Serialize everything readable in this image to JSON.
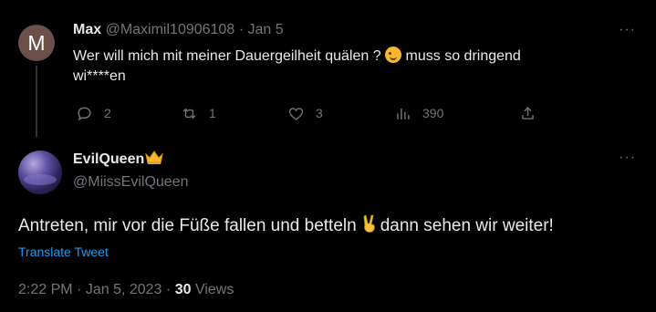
{
  "reply_tweet": {
    "avatar_letter": "M",
    "display_name": "Max",
    "handle": "@Maximil10906108",
    "separator": "·",
    "date": "Jan 5",
    "text_line1": "Wer will mich mit meiner Dauergeilheit quälen ?",
    "text_line1b": "muss so dringend",
    "text_line2": "wi****en",
    "more": "···",
    "actions": {
      "replies": "2",
      "retweets": "1",
      "likes": "3",
      "views": "390"
    }
  },
  "main_tweet": {
    "display_name": "EvilQueen",
    "handle": "@MiissEvilQueen",
    "more": "···",
    "text_part1": "Antreten, mir vor die Füße fallen und betteln",
    "text_part2": "dann sehen wir weiter!",
    "translate_label": "Translate Tweet",
    "time": "2:22 PM",
    "dot": "·",
    "date": "Jan 5, 2023",
    "views_count": "30",
    "views_label": "Views"
  },
  "colors": {
    "background": "#000000",
    "text": "#e7e9ea",
    "muted": "#71767b",
    "link": "#1d9bf0",
    "avatar_m": "#6b4f49"
  },
  "icons": {
    "reply": "reply-icon",
    "retweet": "retweet-icon",
    "like": "heart-icon",
    "views": "views-icon",
    "share": "share-icon",
    "more": "more-icon",
    "crown": "crown-emoji",
    "wink": "wink-emoji",
    "victory": "victory-hand-emoji"
  }
}
